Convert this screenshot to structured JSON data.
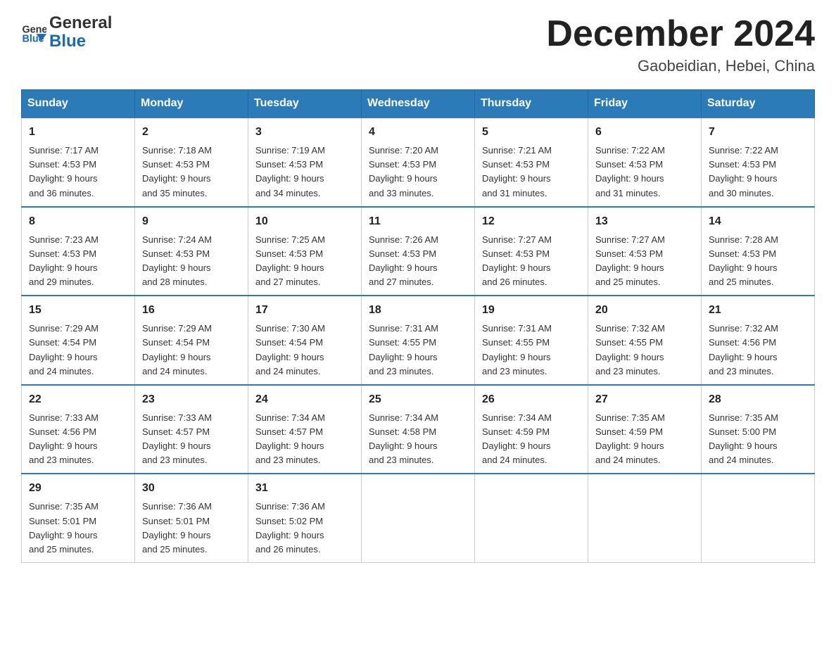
{
  "header": {
    "logo_line1": "General",
    "logo_line2": "Blue",
    "month_title": "December 2024",
    "location": "Gaobeidian, Hebei, China"
  },
  "days_of_week": [
    "Sunday",
    "Monday",
    "Tuesday",
    "Wednesday",
    "Thursday",
    "Friday",
    "Saturday"
  ],
  "weeks": [
    [
      {
        "day": "1",
        "sunrise": "7:17 AM",
        "sunset": "4:53 PM",
        "daylight": "9 hours and 36 minutes."
      },
      {
        "day": "2",
        "sunrise": "7:18 AM",
        "sunset": "4:53 PM",
        "daylight": "9 hours and 35 minutes."
      },
      {
        "day": "3",
        "sunrise": "7:19 AM",
        "sunset": "4:53 PM",
        "daylight": "9 hours and 34 minutes."
      },
      {
        "day": "4",
        "sunrise": "7:20 AM",
        "sunset": "4:53 PM",
        "daylight": "9 hours and 33 minutes."
      },
      {
        "day": "5",
        "sunrise": "7:21 AM",
        "sunset": "4:53 PM",
        "daylight": "9 hours and 31 minutes."
      },
      {
        "day": "6",
        "sunrise": "7:22 AM",
        "sunset": "4:53 PM",
        "daylight": "9 hours and 31 minutes."
      },
      {
        "day": "7",
        "sunrise": "7:22 AM",
        "sunset": "4:53 PM",
        "daylight": "9 hours and 30 minutes."
      }
    ],
    [
      {
        "day": "8",
        "sunrise": "7:23 AM",
        "sunset": "4:53 PM",
        "daylight": "9 hours and 29 minutes."
      },
      {
        "day": "9",
        "sunrise": "7:24 AM",
        "sunset": "4:53 PM",
        "daylight": "9 hours and 28 minutes."
      },
      {
        "day": "10",
        "sunrise": "7:25 AM",
        "sunset": "4:53 PM",
        "daylight": "9 hours and 27 minutes."
      },
      {
        "day": "11",
        "sunrise": "7:26 AM",
        "sunset": "4:53 PM",
        "daylight": "9 hours and 27 minutes."
      },
      {
        "day": "12",
        "sunrise": "7:27 AM",
        "sunset": "4:53 PM",
        "daylight": "9 hours and 26 minutes."
      },
      {
        "day": "13",
        "sunrise": "7:27 AM",
        "sunset": "4:53 PM",
        "daylight": "9 hours and 25 minutes."
      },
      {
        "day": "14",
        "sunrise": "7:28 AM",
        "sunset": "4:53 PM",
        "daylight": "9 hours and 25 minutes."
      }
    ],
    [
      {
        "day": "15",
        "sunrise": "7:29 AM",
        "sunset": "4:54 PM",
        "daylight": "9 hours and 24 minutes."
      },
      {
        "day": "16",
        "sunrise": "7:29 AM",
        "sunset": "4:54 PM",
        "daylight": "9 hours and 24 minutes."
      },
      {
        "day": "17",
        "sunrise": "7:30 AM",
        "sunset": "4:54 PM",
        "daylight": "9 hours and 24 minutes."
      },
      {
        "day": "18",
        "sunrise": "7:31 AM",
        "sunset": "4:55 PM",
        "daylight": "9 hours and 23 minutes."
      },
      {
        "day": "19",
        "sunrise": "7:31 AM",
        "sunset": "4:55 PM",
        "daylight": "9 hours and 23 minutes."
      },
      {
        "day": "20",
        "sunrise": "7:32 AM",
        "sunset": "4:55 PM",
        "daylight": "9 hours and 23 minutes."
      },
      {
        "day": "21",
        "sunrise": "7:32 AM",
        "sunset": "4:56 PM",
        "daylight": "9 hours and 23 minutes."
      }
    ],
    [
      {
        "day": "22",
        "sunrise": "7:33 AM",
        "sunset": "4:56 PM",
        "daylight": "9 hours and 23 minutes."
      },
      {
        "day": "23",
        "sunrise": "7:33 AM",
        "sunset": "4:57 PM",
        "daylight": "9 hours and 23 minutes."
      },
      {
        "day": "24",
        "sunrise": "7:34 AM",
        "sunset": "4:57 PM",
        "daylight": "9 hours and 23 minutes."
      },
      {
        "day": "25",
        "sunrise": "7:34 AM",
        "sunset": "4:58 PM",
        "daylight": "9 hours and 23 minutes."
      },
      {
        "day": "26",
        "sunrise": "7:34 AM",
        "sunset": "4:59 PM",
        "daylight": "9 hours and 24 minutes."
      },
      {
        "day": "27",
        "sunrise": "7:35 AM",
        "sunset": "4:59 PM",
        "daylight": "9 hours and 24 minutes."
      },
      {
        "day": "28",
        "sunrise": "7:35 AM",
        "sunset": "5:00 PM",
        "daylight": "9 hours and 24 minutes."
      }
    ],
    [
      {
        "day": "29",
        "sunrise": "7:35 AM",
        "sunset": "5:01 PM",
        "daylight": "9 hours and 25 minutes."
      },
      {
        "day": "30",
        "sunrise": "7:36 AM",
        "sunset": "5:01 PM",
        "daylight": "9 hours and 25 minutes."
      },
      {
        "day": "31",
        "sunrise": "7:36 AM",
        "sunset": "5:02 PM",
        "daylight": "9 hours and 26 minutes."
      },
      null,
      null,
      null,
      null
    ]
  ],
  "labels": {
    "sunrise": "Sunrise: ",
    "sunset": "Sunset: ",
    "daylight": "Daylight: "
  }
}
